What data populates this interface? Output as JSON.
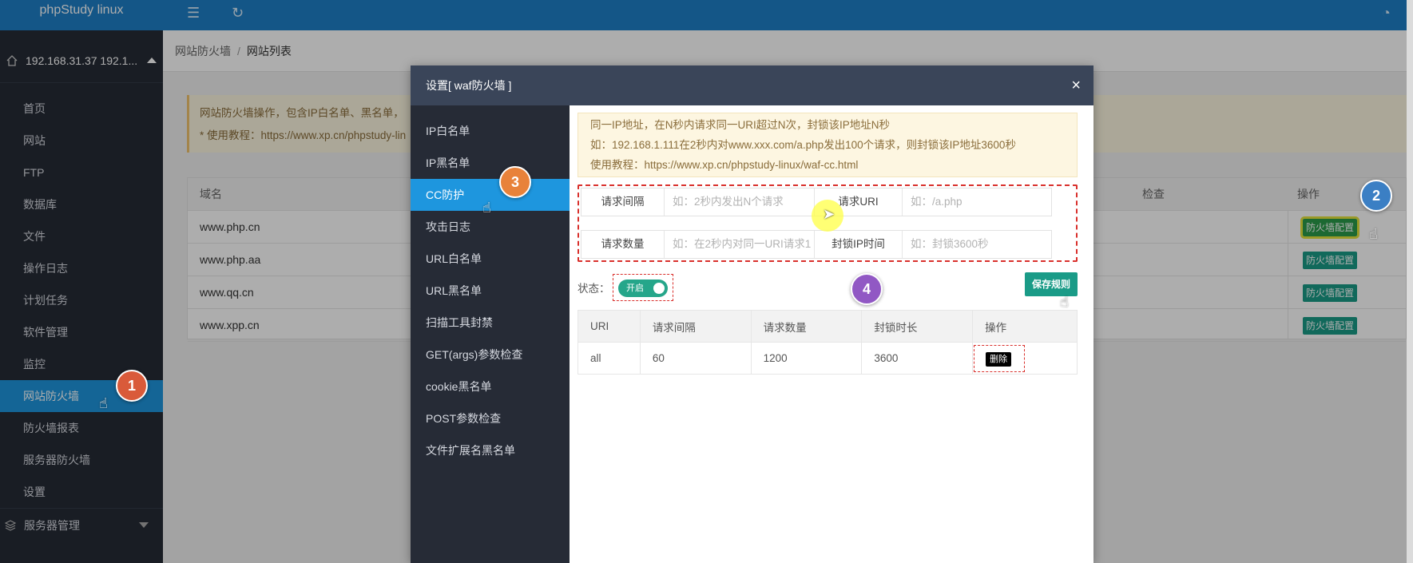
{
  "app": {
    "title": "phpStudy linux"
  },
  "host": {
    "label": "192.168.31.37 192.1..."
  },
  "sidebar": {
    "items": [
      {
        "label": "首页"
      },
      {
        "label": "网站"
      },
      {
        "label": "FTP"
      },
      {
        "label": "数据库"
      },
      {
        "label": "文件"
      },
      {
        "label": "操作日志"
      },
      {
        "label": "计划任务"
      },
      {
        "label": "软件管理"
      },
      {
        "label": "监控"
      },
      {
        "label": "网站防火墙"
      },
      {
        "label": "防火墙报表"
      },
      {
        "label": "服务器防火墙"
      },
      {
        "label": "设置"
      }
    ],
    "active_index": 9,
    "server_group": "服务器管理"
  },
  "breadcrumb": {
    "parent": "网站防火墙",
    "current": "网站列表"
  },
  "notice": {
    "line1": "网站防火墙操作，包含IP白名单、黑名单，",
    "line2": "* 使用教程：https://www.xp.cn/phpstudy-lin"
  },
  "sites_table": {
    "headers": {
      "domain": "域名",
      "check": "检查",
      "ops": "操作"
    },
    "rows": [
      {
        "domain": "www.php.cn",
        "action": "防火墙配置"
      },
      {
        "domain": "www.php.aa",
        "action": "防火墙配置"
      },
      {
        "domain": "www.qq.cn",
        "action": "防火墙配置"
      },
      {
        "domain": "www.xpp.cn",
        "action": "防火墙配置"
      }
    ]
  },
  "modal": {
    "title": "设置[ waf防火墙 ]",
    "close": "×",
    "nav": [
      {
        "label": "IP白名单"
      },
      {
        "label": "IP黑名单"
      },
      {
        "label": "CC防护"
      },
      {
        "label": "攻击日志"
      },
      {
        "label": "URL白名单"
      },
      {
        "label": "URL黑名单"
      },
      {
        "label": "扫描工具封禁"
      },
      {
        "label": "GET(args)参数检查"
      },
      {
        "label": "cookie黑名单"
      },
      {
        "label": "POST参数检查"
      },
      {
        "label": "文件扩展名黑名单"
      }
    ],
    "active_nav": 2,
    "tip": {
      "line1": "同一IP地址，在N秒内请求同一URI超过N次，封锁该IP地址N秒",
      "line2": "如：192.168.1.111在2秒内对www.xxx.com/a.php发出100个请求，则封锁该IP地址3600秒",
      "line3": "使用教程：https://www.xp.cn/phpstudy-linux/waf-cc.html"
    },
    "form": {
      "interval_label": "请求间隔",
      "interval_placeholder": "如：2秒内发出N个请求",
      "uri_label": "请求URI",
      "uri_placeholder": "如：/a.php",
      "count_label": "请求数量",
      "count_placeholder": "如：在2秒内对同一URI请求1",
      "block_label": "封锁IP时间",
      "block_placeholder": "如：封锁3600秒"
    },
    "status_label": "状态：",
    "toggle_label": "开启",
    "save_label": "保存规则",
    "rules_table": {
      "headers": [
        "URI",
        "请求间隔",
        "请求数量",
        "封锁时长",
        "操作"
      ],
      "rows": [
        {
          "uri": "all",
          "interval": "60",
          "count": "1200",
          "duration": "3600",
          "action": "删除"
        }
      ]
    }
  },
  "badges": {
    "b1": "1",
    "b2": "2",
    "b3": "3",
    "b4": "4"
  },
  "colors": {
    "primary": "#1e7fc8",
    "sidebar": "#262b36",
    "active": "#1e96de",
    "teal": "#1a9b87",
    "danger_outline": "#d9302c"
  }
}
